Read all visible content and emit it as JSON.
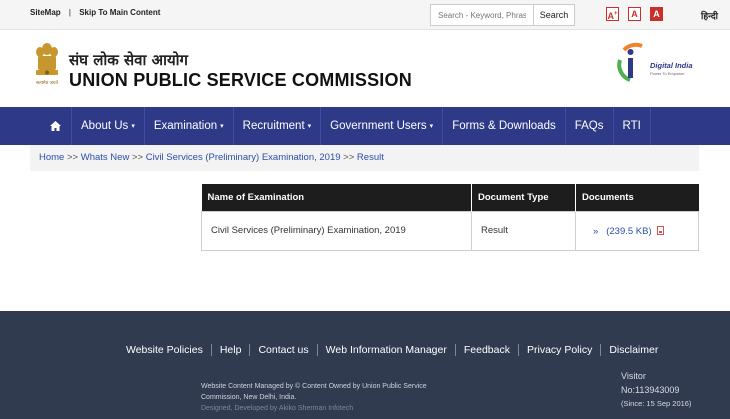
{
  "topbar": {
    "sitemap_label": "SiteMap",
    "separator": "|",
    "skip_label": "Skip To Main Content",
    "search_placeholder": "Search - Keyword, Phrase",
    "search_button": "Search",
    "font_buttons": [
      "A",
      "A",
      "A"
    ],
    "font_plus": "+",
    "language_label": "हिन्दी",
    "accent_color": "#c9302c"
  },
  "header": {
    "title_hindi": "संघ लोक सेवा आयोग",
    "title_english": "UNION PUBLIC SERVICE COMMISSION",
    "emblem_caption": "सत्यमेव जयते",
    "digital_india_title": "Digital India",
    "digital_india_tagline": "Power To Empower"
  },
  "nav": {
    "home_icon": "home-icon",
    "items": [
      {
        "label": "About Us",
        "dropdown": true
      },
      {
        "label": "Examination",
        "dropdown": true
      },
      {
        "label": "Recruitment",
        "dropdown": true
      },
      {
        "label": "Government Users",
        "dropdown": true
      },
      {
        "label": "Forms & Downloads",
        "dropdown": false
      },
      {
        "label": "FAQs",
        "dropdown": false
      },
      {
        "label": "RTI",
        "dropdown": false
      }
    ],
    "caret": "▾",
    "background_color": "#2e3a87"
  },
  "breadcrumb": {
    "home": "Home",
    "whats_new": "Whats New",
    "exam": "Civil Services (Preliminary) Examination, 2019",
    "current": "Result",
    "separator": ">>"
  },
  "table": {
    "headers": [
      "Name of Examination",
      "Document Type",
      "Documents"
    ],
    "rows": [
      {
        "exam": "Civil Services (Preliminary) Examination, 2019",
        "doc_type": "Result",
        "doc_arrow": "»",
        "doc_size": "(239.5 KB)",
        "doc_icon": "pdf-icon"
      }
    ]
  },
  "footer": {
    "links": [
      "Website Policies",
      "Help",
      "Contact us",
      "Web Information Manager",
      "Feedback",
      "Privacy Policy",
      "Disclaimer"
    ],
    "managed_text": "Website Content Managed by © Content Owned by Union Public Service Commission, New Delhi, India.",
    "developed_text": "Designed, Developed by Akiko Sherman Infotech",
    "visitor_label": "Visitor",
    "visitor_count": "No:113943009",
    "visitor_since": "(Since: 15 Sep 2016)",
    "background_color": "#303b4f"
  }
}
